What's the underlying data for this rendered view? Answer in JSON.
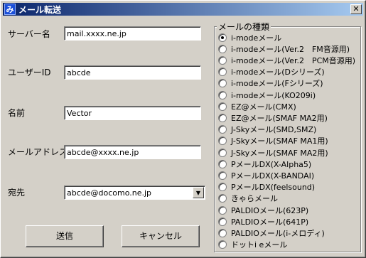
{
  "window": {
    "title": "メール転送",
    "icon_glyph": "み",
    "close_glyph": "✕"
  },
  "form": {
    "server_label": "サーバー名",
    "server_value": "mail.xxxx.ne.jp",
    "userid_label": "ユーザーID",
    "userid_value": "abcde",
    "name_label": "名前",
    "name_value": "Vector",
    "mail_label": "メールアドレス",
    "mail_value": "abcde@xxxx.ne.jp",
    "to_label": "宛先",
    "to_value": "abcde@docomo.ne.jp",
    "to_arrow": "▼"
  },
  "buttons": {
    "send_label": "送信",
    "cancel_label": "キャンセル"
  },
  "mail_types": {
    "title": "メールの種類",
    "selected_index": 0,
    "options": [
      "i-modeメール",
      "i-modeメール(Ver.2　FM音源用)",
      "i-modeメール(Ver.2　PCM音源用)",
      "i-modeメール(Dシリーズ)",
      "i-modeメール(Fシリーズ)",
      "i-modeメール(KO209i)",
      "EZ@メール(CMX)",
      "EZ@メール(SMAF MA2用)",
      "J-Skyメール(SMD,SMZ)",
      "J-Skyメール(SMAF MA1用)",
      "J-Skyメール(SMAF MA2用)",
      "PメールDX(X-Alpha5)",
      "PメールDX(X-BANDAI)",
      "PメールDX(feelsound)",
      "きゃらメール",
      "PALDIOメール(623P)",
      "PALDIOメール(641P)",
      "PALDIOメール(i-メロディ)",
      "ドットi eメール"
    ]
  }
}
